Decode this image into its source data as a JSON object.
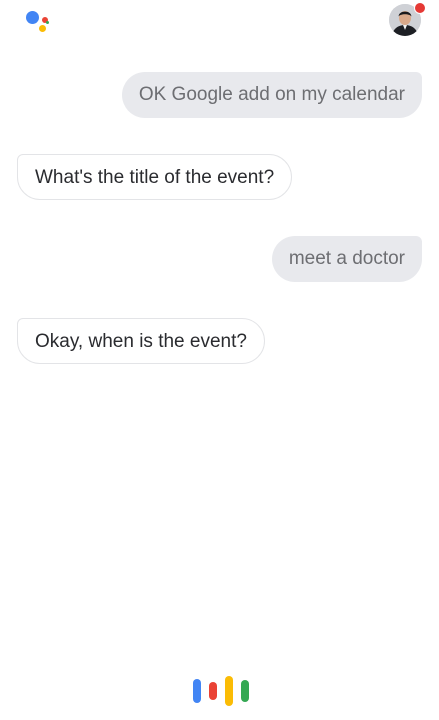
{
  "header": {
    "assistant_logo_icon": "google-assistant-logo",
    "avatar_icon": "user-avatar",
    "notification_badge_color": "#E53935"
  },
  "conversation": {
    "messages": [
      {
        "speaker": "user",
        "text": "OK Google add on my calendar"
      },
      {
        "speaker": "assistant",
        "text": "What's the title of the event?"
      },
      {
        "speaker": "user",
        "text": "meet a doctor"
      },
      {
        "speaker": "assistant",
        "text": "Okay, when is the event?"
      }
    ]
  },
  "listening_indicator": {
    "icon": "voice-listening-bars",
    "colors": [
      "#4285F4",
      "#EA4335",
      "#FBBC05",
      "#34A853"
    ]
  }
}
